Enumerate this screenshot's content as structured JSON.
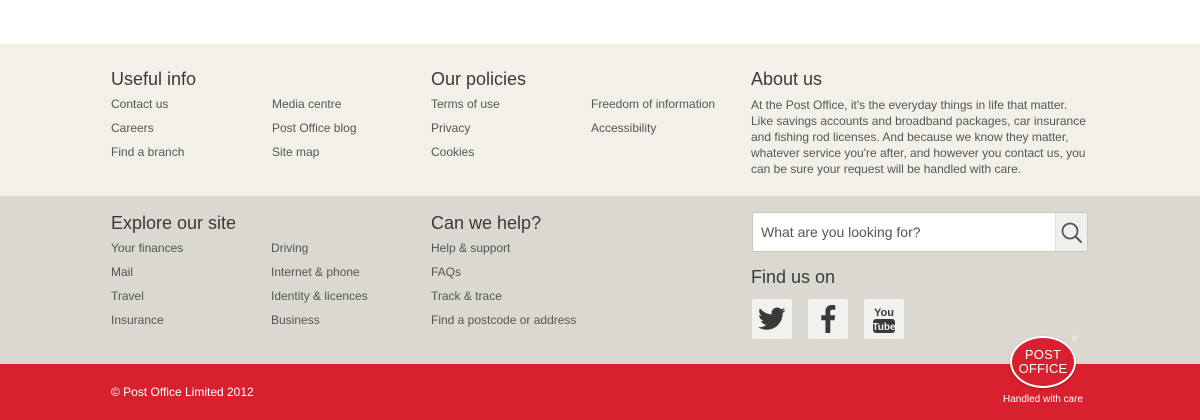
{
  "useful_info": {
    "heading": "Useful info",
    "col1": [
      "Contact us",
      "Careers",
      "Find a branch"
    ],
    "col2": [
      "Media centre",
      "Post Office blog",
      "Site map"
    ]
  },
  "our_policies": {
    "heading": "Our policies",
    "col1": [
      "Terms of use",
      "Privacy",
      "Cookies"
    ],
    "col2": [
      "Freedom of information",
      "Accessibility"
    ]
  },
  "about_us": {
    "heading": "About us",
    "text": "At the Post Office, it's the everyday things in life that matter. Like savings accounts and broadband packages, car insurance and fishing rod licenses. And because we know they matter, whatever service you're after, and however you contact us, you can be sure your request will be handled with care."
  },
  "explore": {
    "heading": "Explore our site",
    "col1": [
      "Your finances",
      "Mail",
      "Travel",
      "Insurance"
    ],
    "col2": [
      "Driving",
      "Internet & phone",
      "Identity & licences",
      "Business"
    ]
  },
  "help": {
    "heading": "Can we help?",
    "links": [
      "Help & support",
      "FAQs",
      "Track & trace",
      "Find a postcode or address"
    ]
  },
  "search": {
    "placeholder": "What are you looking for?",
    "icon": "search-icon"
  },
  "find_us": {
    "heading": "Find us on",
    "networks": [
      "twitter-icon",
      "facebook-icon",
      "youtube-icon"
    ],
    "youtube_text_top": "You",
    "youtube_text_bottom": "Tube"
  },
  "footer": {
    "copyright": "© Post Office Limited 2012",
    "logo_line1": "POST",
    "logo_line2": "OFFICE",
    "logo_reg": "®",
    "tagline": "Handled with care"
  },
  "colors": {
    "band_light": "#f3f0ea",
    "band_grey": "#dbd8d1",
    "brand_red": "#d8202e"
  }
}
